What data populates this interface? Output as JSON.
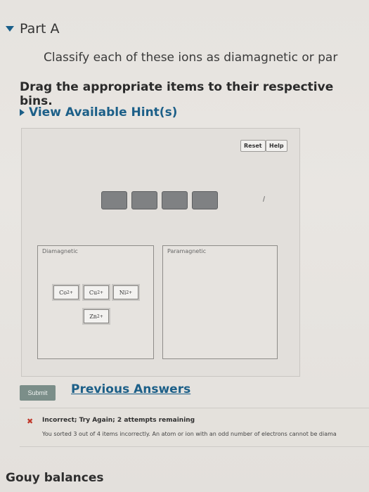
{
  "part": {
    "title": "Part A",
    "question": "Classify each of these ions as diamagnetic or par",
    "instruction": "Drag the appropriate items to their respective bins.",
    "hint_label": "View Available Hint(s)"
  },
  "workspace": {
    "reset_label": "Reset",
    "help_label": "Help",
    "empty_slots": 4,
    "bins": [
      {
        "label": "Diamagnetic",
        "items": [
          {
            "base": "Co",
            "charge": "2+"
          },
          {
            "base": "Cu",
            "charge": "2+"
          },
          {
            "base": "Ni",
            "charge": "2+"
          },
          {
            "base": "Zn",
            "charge": "2+"
          }
        ]
      },
      {
        "label": "Paramagnetic",
        "items": []
      }
    ]
  },
  "actions": {
    "submit_label": "Submit",
    "previous_answers_label": "Previous Answers"
  },
  "feedback": {
    "status_icon": "x-icon",
    "title": "Incorrect; Try Again; 2 attempts remaining",
    "detail": "You sorted 3 out of 4 items incorrectly. An atom or ion with an odd number of electrons cannot be diama"
  },
  "next_section": {
    "title": "Gouy balances"
  },
  "colors": {
    "link": "#1c5f88",
    "error": "#c0392b",
    "submit_bg": "#7b8e89"
  }
}
